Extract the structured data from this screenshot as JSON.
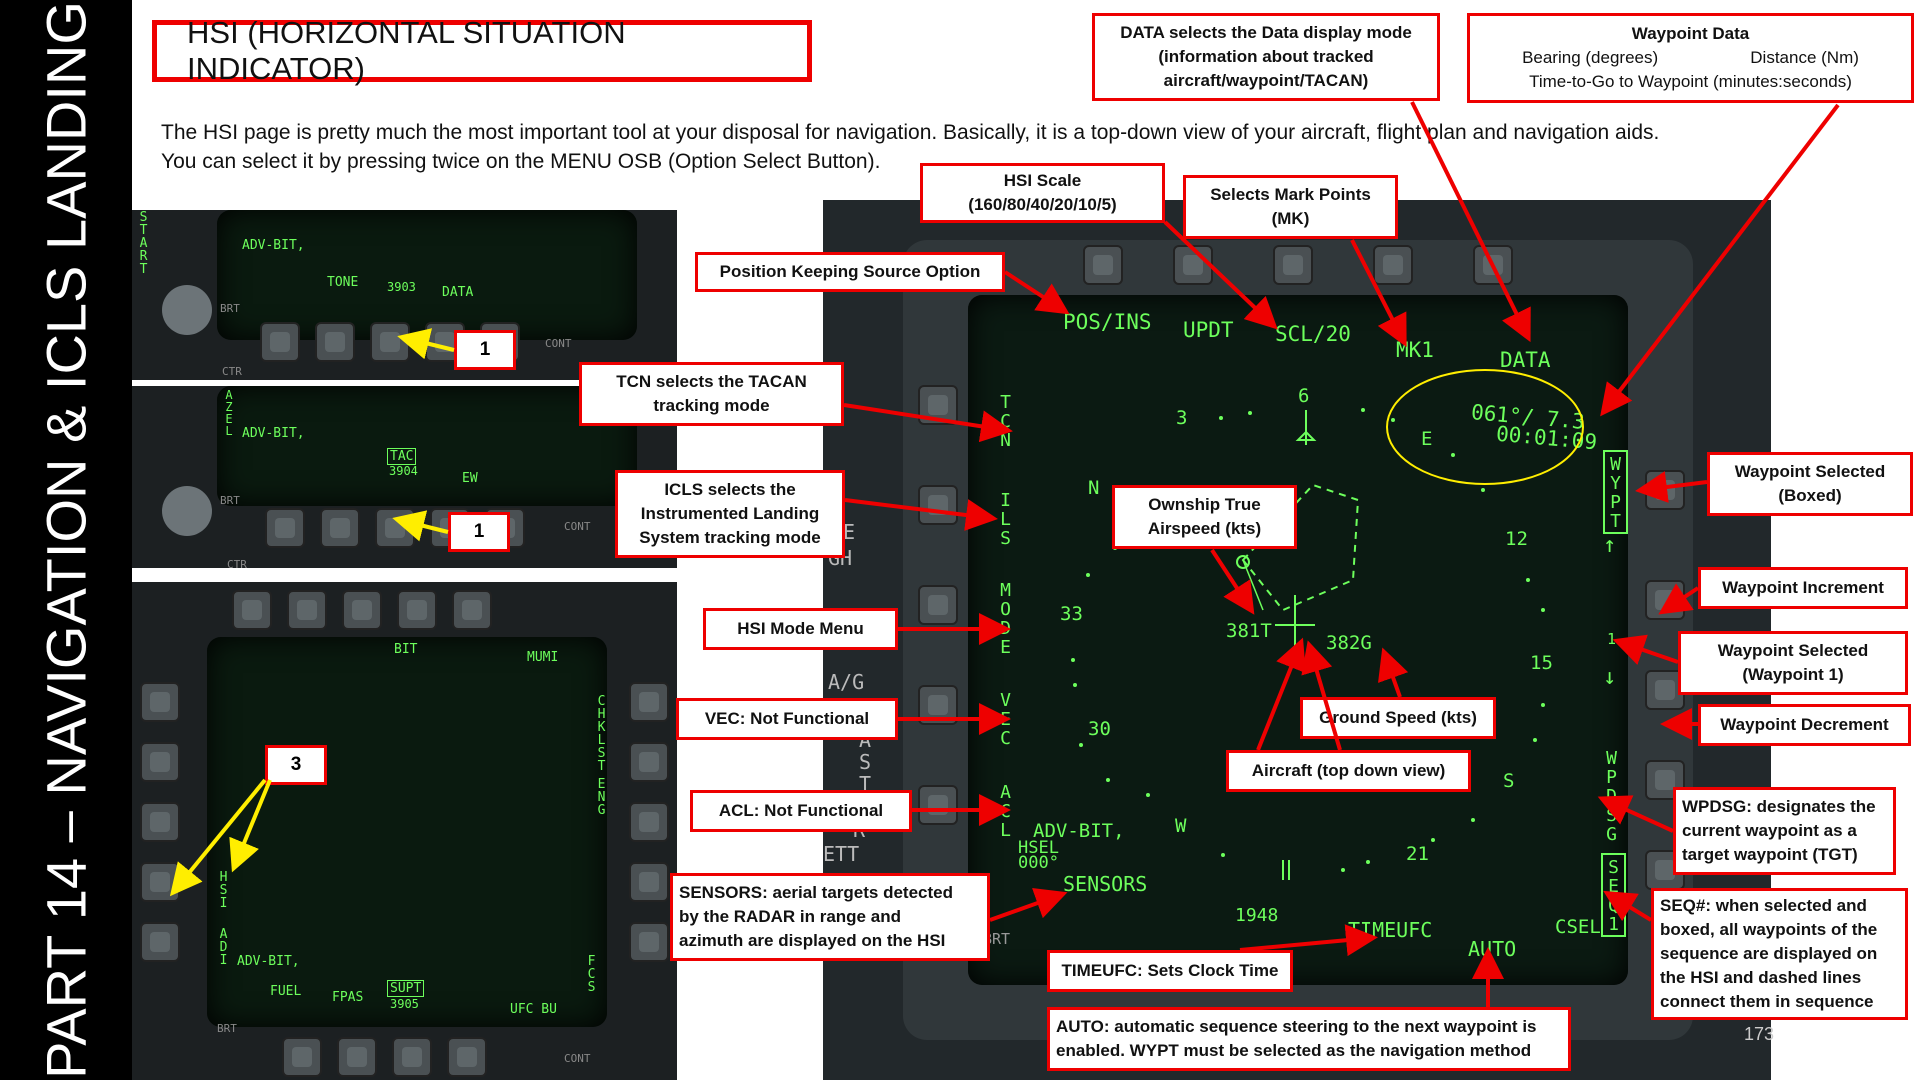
{
  "sidebar": {
    "title": "PART 14 – NAVIGATION & ICLS LANDING"
  },
  "page": {
    "title": "HSI (HORIZONTAL SITUATION INDICATOR)",
    "intro_line1": "The HSI page is pretty much the most important tool at your disposal for navigation. Basically, it is a top-down view of your aircraft, flight plan and navigation aids.",
    "intro_line2": "You can select it by pressing twice on the MENU OSB (Option Select Button).",
    "page_number": "173"
  },
  "step_panels": {
    "panel1": {
      "labels": {
        "adv_bit": "ADV-BIT,",
        "tone": "TONE",
        "num": "3903",
        "data": "DATA",
        "brt": "BRT",
        "cont": "CONT",
        "ctr": "CTR",
        "start": "START"
      },
      "badge": "1"
    },
    "panel2": {
      "labels": {
        "azel": "AZEL",
        "adv_bit": "ADV-BIT,",
        "tac": "TAC",
        "num": "3904",
        "ew": "EW",
        "brt": "BRT",
        "cont": "CONT",
        "ctr": "CTR"
      },
      "badge": "1"
    },
    "panel3": {
      "labels": {
        "bit": "BIT",
        "mumi": "MUMI",
        "chklst": "CHKLST",
        "eng": "ENG",
        "hsi": "HSI",
        "adi": "ADI",
        "adv_bit": "ADV-BIT,",
        "fuel": "FUEL",
        "fpas": "FPAS",
        "supt": "SUPT",
        "num": "3905",
        "ufc_bu": "UFC BU",
        "fcs": "FCS",
        "brt": "BRT",
        "cont": "CONT"
      },
      "badge": "3"
    }
  },
  "hsi_display": {
    "top_row": [
      "POS/INS",
      "UPDT",
      "SCL/20",
      "MK1",
      "DATA"
    ],
    "left_col": [
      "TCN",
      "ILS",
      "MODE",
      "VEC",
      "ACL"
    ],
    "right_col": [
      "WYPT",
      "1",
      "WPDSG",
      "SEQ1"
    ],
    "bottom_row": [
      "SENSORS",
      "1948",
      "TIMEUFC",
      "AUTO",
      "CSEL"
    ],
    "waypoint_data": {
      "bearing_distance": "061°/ 7.3",
      "time_to_go": "00:01:09"
    },
    "compass": [
      "N",
      "3",
      "6",
      "E",
      "12",
      "15",
      "S",
      "21",
      "W",
      "30",
      "33"
    ],
    "true_airspeed": "381T",
    "ground_speed": "382G",
    "adv_bit": "ADV-BIT,",
    "hsel": "HSEL",
    "hsel_val": "000°",
    "brt": "BRT",
    "side_text": [
      "A/G",
      "AST",
      "R",
      "ETT",
      "E",
      "GH"
    ]
  },
  "callouts": {
    "position_keeping": "Position Keeping Source Option",
    "hsi_scale_title": "HSI Scale",
    "hsi_scale_values": "(160/80/40/20/10/5)",
    "mark_points_title": "Selects Mark Points",
    "mark_points_sub": "(MK)",
    "data_mode": [
      "DATA selects the Data display mode",
      "(information about tracked",
      "aircraft/waypoint/TACAN)"
    ],
    "waypoint_data_title": "Waypoint Data",
    "waypoint_data_bearing": "Bearing (degrees)",
    "waypoint_data_distance": "Distance (Nm)",
    "waypoint_data_ttg": "Time-to-Go to Waypoint (minutes:seconds)",
    "tcn": [
      "TCN selects the TACAN",
      "tracking mode"
    ],
    "icls": [
      "ICLS selects the",
      "Instrumented Landing",
      "System tracking mode"
    ],
    "hsi_mode_menu": "HSI Mode Menu",
    "vec": "VEC: Not Functional",
    "acl": "ACL: Not Functional",
    "sensors": [
      "SENSORS: aerial targets detected",
      "by the RADAR in range and",
      "azimuth are displayed on the HSI"
    ],
    "ownship_tas": [
      "Ownship True",
      "Airspeed (kts)"
    ],
    "ground_speed": "Ground Speed (kts)",
    "aircraft_top_down": "Aircraft (top down view)",
    "timeufc": "TIMEUFC: Sets Clock Time",
    "auto": [
      "AUTO: automatic sequence steering to the next waypoint is",
      "enabled. WYPT must be selected as the navigation method"
    ],
    "waypoint_selected_boxed": [
      "Waypoint Selected",
      "(Boxed)"
    ],
    "waypoint_increment": "Waypoint Increment",
    "waypoint_selected_1": [
      "Waypoint Selected",
      "(Waypoint 1)"
    ],
    "waypoint_decrement": "Waypoint Decrement",
    "wpdsg": [
      "WPDSG: designates the",
      "current waypoint as a",
      "target waypoint (TGT)"
    ],
    "seq": [
      "SEQ#: when selected and",
      "boxed, all waypoints of the",
      "sequence are displayed on",
      "the HSI and dashed lines",
      "connect them in sequence"
    ]
  },
  "colors": {
    "accent_red": "#e00000",
    "display_green": "#6dff5c",
    "arrow_yellow": "#ffee00",
    "sidebar_black": "#000000"
  }
}
